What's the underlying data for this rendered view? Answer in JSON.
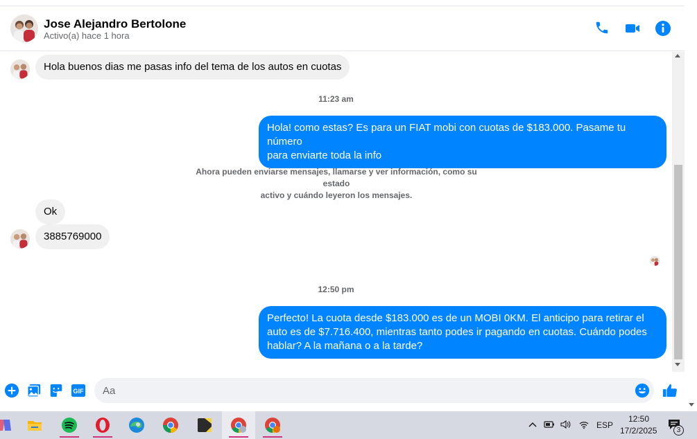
{
  "header": {
    "contact_name": "Jose Alejandro Bertolone",
    "contact_status": "Activo(a) hace 1 hora",
    "icons": [
      "phone-icon",
      "video-camera-icon",
      "info-icon"
    ]
  },
  "messages": {
    "m1": "Hola buenos dias me pasas info del tema de los autos en cuotas",
    "ts1": "11:23 am",
    "m2_line1": "Hola! como estas? Es para un FIAT mobi con cuotas de $183.000. Pasame tu número",
    "m2_line2": "para enviarte toda la info",
    "notice_line1": "Ahora pueden enviarse mensajes, llamarse y ver información, como su estado",
    "notice_line2": "activo y cuándo leyeron los mensajes.",
    "m3": "Ok",
    "m4": "3885769000",
    "ts2": "12:50 pm",
    "m5_line1": "Perfecto! La cuota desde $183.000 es de un MOBI 0KM. El anticipo para retirar el",
    "m5_line2": "auto es de $7.716.400, mientras tanto podes ir pagando en cuotas. Cuándo podes",
    "m5_line3": "hablar? A la mañana o a la tarde?"
  },
  "composer": {
    "placeholder": "Aa",
    "gif_label": "GIF",
    "icons": [
      "plus-icon",
      "image-icon",
      "sticker-icon",
      "gif-icon",
      "emoji-icon",
      "thumbs-up-icon"
    ]
  },
  "taskbar": {
    "apps": [
      "copilot",
      "file-explorer",
      "spotify",
      "opera",
      "edge",
      "chrome",
      "sticky-notes",
      "chrome-profile-1",
      "chrome-profile-2"
    ],
    "language": "ESP",
    "time": "12:50",
    "date": "17/2/2025",
    "notification_count": "3"
  },
  "colors": {
    "accent": "#0084ff",
    "incoming_bubble": "#f0f0f0",
    "taskbar": "#d6d9e2"
  }
}
